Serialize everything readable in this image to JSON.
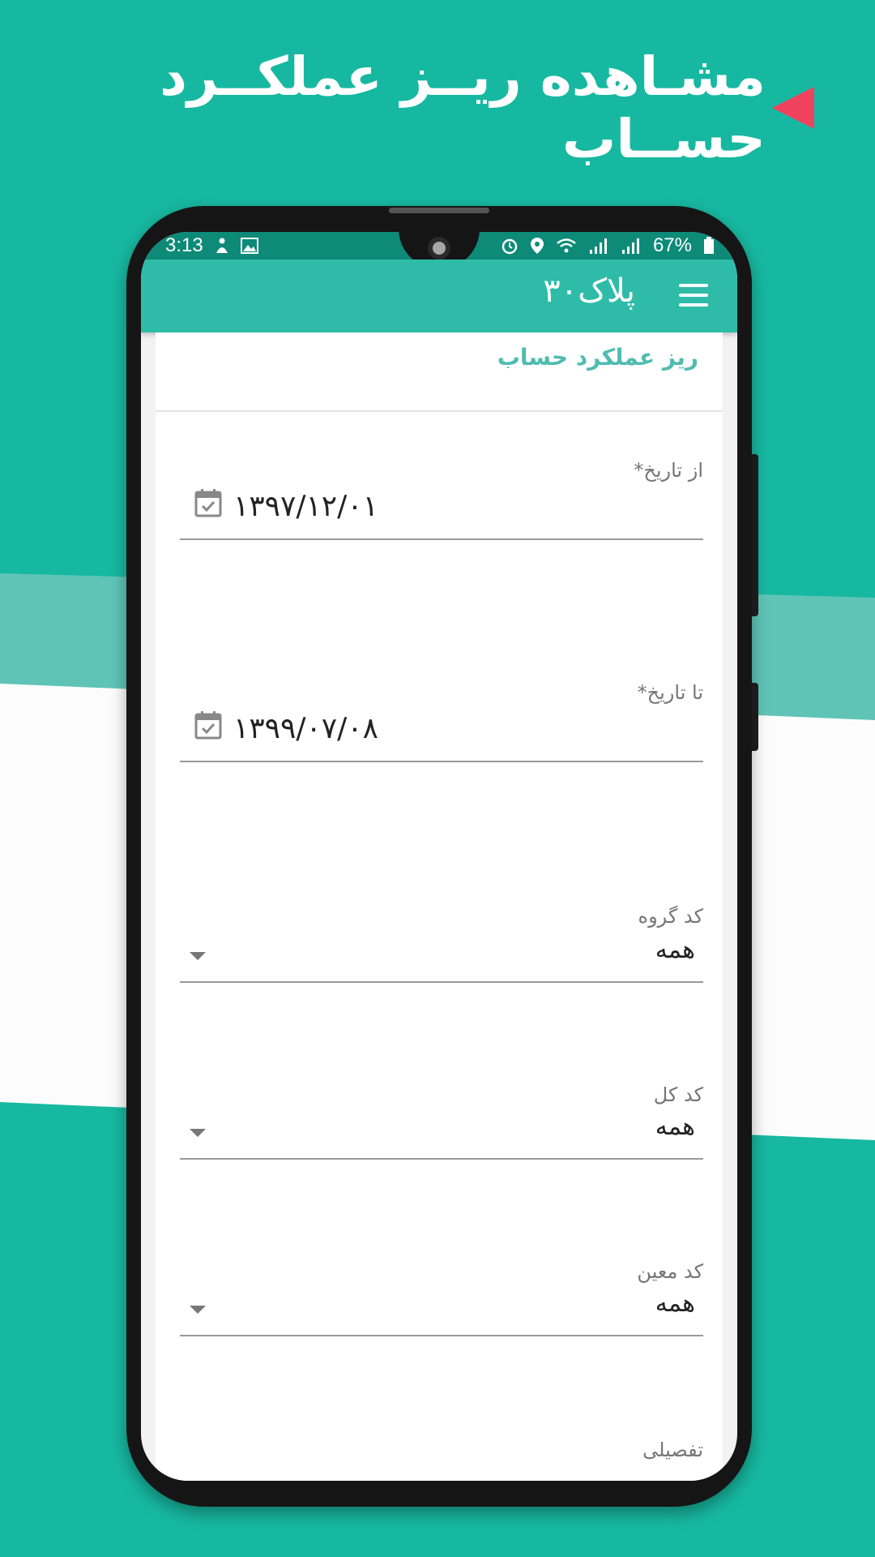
{
  "banner": {
    "title": "مشـاهده ریــز عملکــرد حســاب",
    "accent_color": "#f0425f"
  },
  "status_bar": {
    "time": "3:13",
    "battery": "67%"
  },
  "app_bar": {
    "title": "پلاک۳۰",
    "menu_icon": "hamburger-menu-icon"
  },
  "card": {
    "title": "ریز عملکرد حساب"
  },
  "form": {
    "from_date": {
      "label": "از تاریخ*",
      "value": "۱۳۹۷/۱۲/۰۱",
      "icon": "calendar-icon"
    },
    "to_date": {
      "label": "تا تاریخ*",
      "value": "۱۳۹۹/۰۷/۰۸",
      "icon": "calendar-icon"
    },
    "group_code": {
      "label": "کد گروه",
      "value": "همه"
    },
    "total_code": {
      "label": "کد کل",
      "value": "همه"
    },
    "moein_code": {
      "label": "کد معین",
      "value": "همه"
    },
    "detail": {
      "label": "تفصیلی"
    }
  },
  "colors": {
    "background": "#17b8a1",
    "app_bar": "#2ebca9",
    "status_bar": "#0d8a78",
    "title_text": "#4fbcb0"
  }
}
